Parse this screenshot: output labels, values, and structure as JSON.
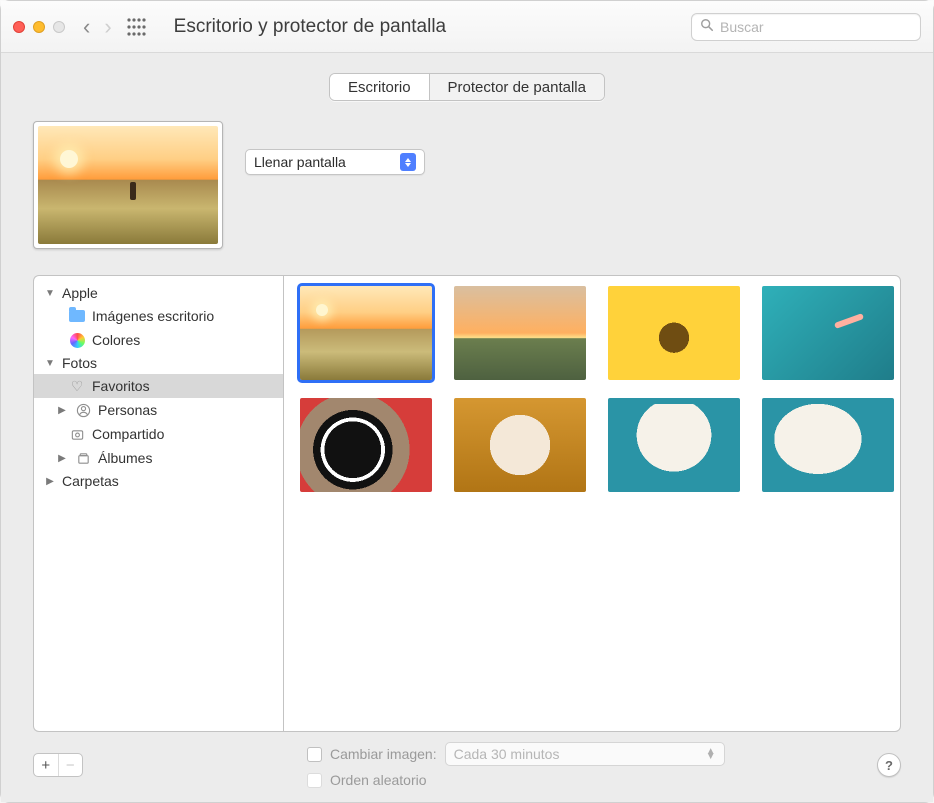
{
  "window": {
    "title": "Escritorio y protector de pantalla"
  },
  "search": {
    "placeholder": "Buscar"
  },
  "tabs": {
    "desktop": "Escritorio",
    "screensaver": "Protector de pantalla"
  },
  "fit": {
    "selected": "Llenar pantalla"
  },
  "sidebar": {
    "apple": {
      "label": "Apple",
      "desktop_pictures": "Imágenes escritorio",
      "colors": "Colores"
    },
    "photos": {
      "label": "Fotos",
      "favorites": "Favoritos",
      "people": "Personas",
      "shared": "Compartido",
      "albums": "Álbumes"
    },
    "folders": {
      "label": "Carpetas"
    }
  },
  "controls": {
    "change_picture": "Cambiar imagen:",
    "interval_selected": "Cada 30 minutos",
    "random": "Orden aleatorio"
  },
  "buttons": {
    "add": "+",
    "remove": "−",
    "help": "?"
  },
  "thumbnails": {
    "count": 8,
    "selected_index": 0
  }
}
